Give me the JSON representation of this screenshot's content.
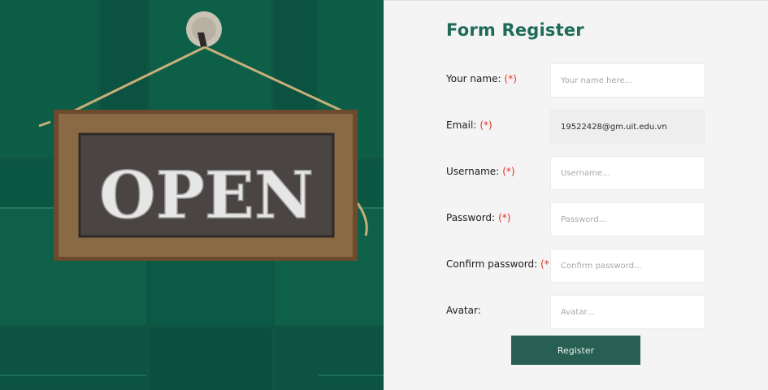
{
  "hero": {
    "sign_text": "OPEN",
    "colors": {
      "door": "#0f5a44",
      "sign_frame": "#6b4a2e",
      "sign_face": "#4a4542",
      "letters": "#e6e6e6"
    }
  },
  "form": {
    "title": "Form Register",
    "required_mark": "(*)",
    "fields": [
      {
        "label": "Your name:",
        "required": true,
        "placeholder": "Your name here...",
        "value": ""
      },
      {
        "label": "Email:",
        "required": true,
        "placeholder": "",
        "value": "19522428@gm.uit.edu.vn"
      },
      {
        "label": "Username:",
        "required": true,
        "placeholder": "Username...",
        "value": ""
      },
      {
        "label": "Password:",
        "required": true,
        "placeholder": "Password...",
        "value": ""
      },
      {
        "label": "Confirm password:",
        "required": true,
        "placeholder": "Confirm password...",
        "value": ""
      },
      {
        "label": "Avatar:",
        "required": false,
        "placeholder": "Avatar...",
        "value": ""
      }
    ],
    "submit_label": "Register",
    "colors": {
      "title": "#1e6b57",
      "required": "#d9342b",
      "button": "#275f52"
    }
  }
}
